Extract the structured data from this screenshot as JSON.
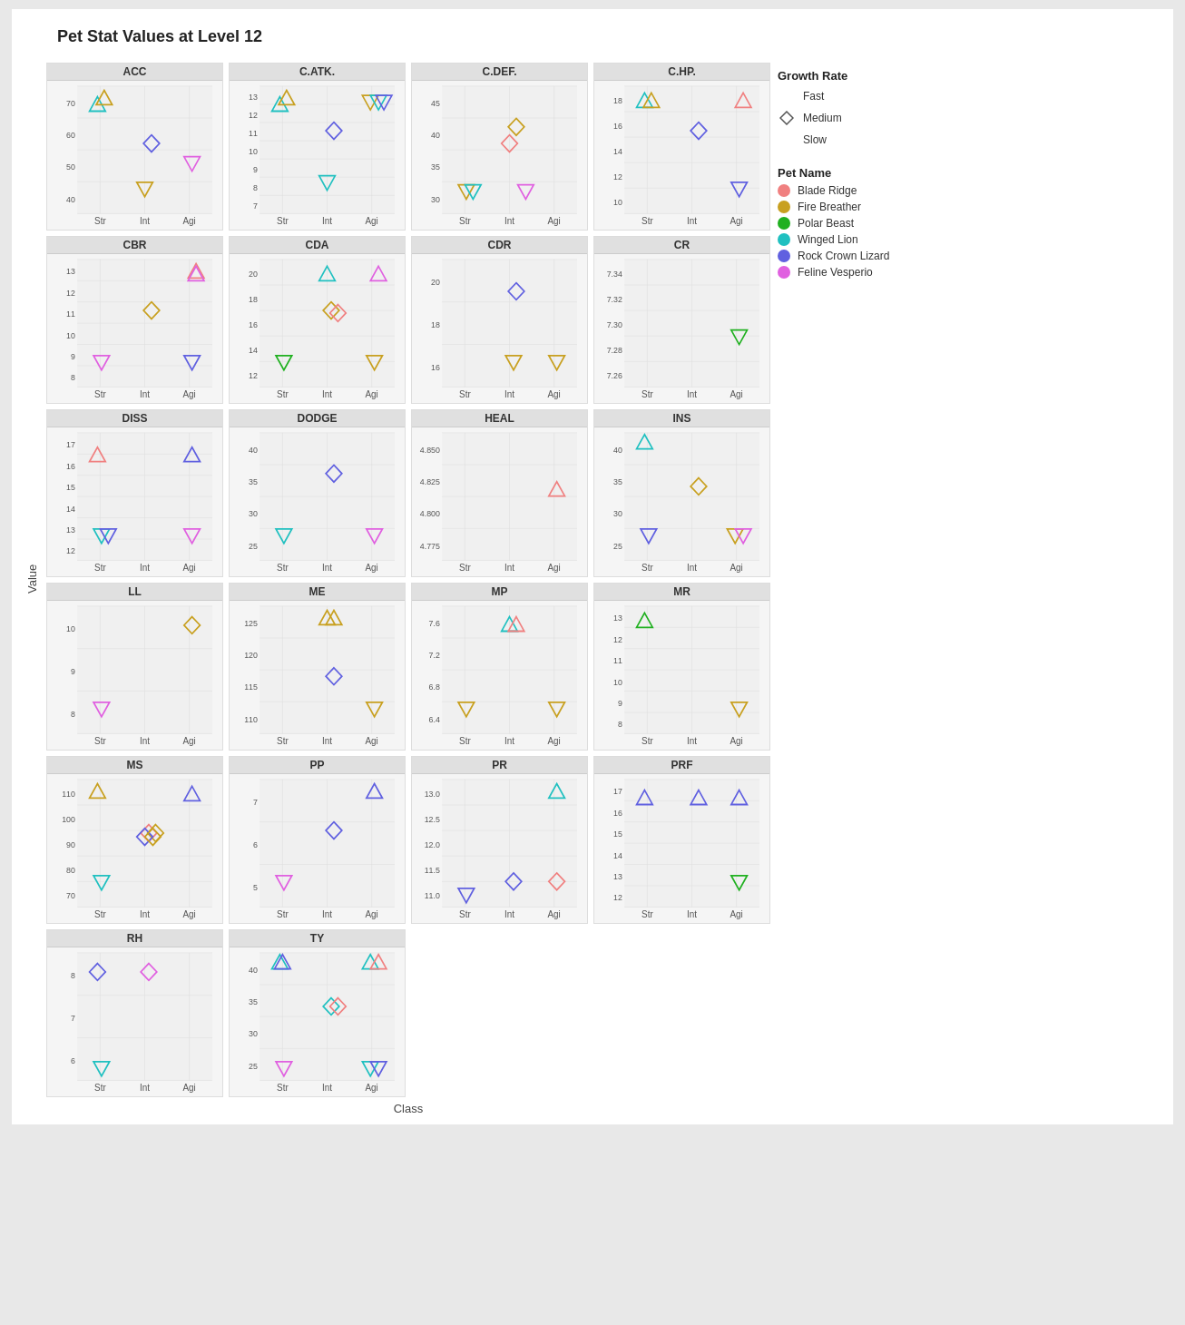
{
  "title": "Pet Stat Values at Level 12",
  "yAxisLabel": "Value",
  "xAxisLabel": "Class",
  "xLabels": [
    "Str",
    "Int",
    "Agi"
  ],
  "legend": {
    "growthRateTitle": "Growth Rate",
    "growthRates": [
      {
        "label": "Fast",
        "shape": "up-triangle"
      },
      {
        "label": "Medium",
        "shape": "diamond"
      },
      {
        "label": "Slow",
        "shape": "down-triangle"
      }
    ],
    "petNameTitle": "Pet Name",
    "petNames": [
      {
        "label": "Blade Ridge",
        "color": "#f08080"
      },
      {
        "label": "Fire Breather",
        "color": "#c8a020"
      },
      {
        "label": "Polar Beast",
        "color": "#20b020"
      },
      {
        "label": "Winged Lion",
        "color": "#20c0c0"
      },
      {
        "label": "Rock Crown Lizard",
        "color": "#6060e0"
      },
      {
        "label": "Feline Vesperio",
        "color": "#e060e0"
      }
    ]
  },
  "plots": [
    {
      "title": "ACC",
      "yMin": 40,
      "yMax": 70,
      "yLabels": [
        "70",
        "60",
        "50",
        "40"
      ],
      "points": [
        {
          "x": 0.15,
          "y": 0.85,
          "shape": "up",
          "color": "#20c0c0"
        },
        {
          "x": 0.2,
          "y": 0.9,
          "shape": "up",
          "color": "#c8a020"
        },
        {
          "x": 0.55,
          "y": 0.55,
          "shape": "diamond",
          "color": "#6060e0"
        },
        {
          "x": 0.5,
          "y": 0.2,
          "shape": "down",
          "color": "#c8a020"
        },
        {
          "x": 0.85,
          "y": 0.4,
          "shape": "down",
          "color": "#e060e0"
        }
      ]
    },
    {
      "title": "C.ATK.",
      "yMin": 7,
      "yMax": 13,
      "yLabels": [
        "13",
        "12",
        "11",
        "10",
        "9",
        "8",
        "7"
      ],
      "points": [
        {
          "x": 0.15,
          "y": 0.85,
          "shape": "up",
          "color": "#20c0c0"
        },
        {
          "x": 0.2,
          "y": 0.9,
          "shape": "up",
          "color": "#c8a020"
        },
        {
          "x": 0.55,
          "y": 0.65,
          "shape": "diamond",
          "color": "#6060e0"
        },
        {
          "x": 0.5,
          "y": 0.25,
          "shape": "down",
          "color": "#20c0c0"
        },
        {
          "x": 0.82,
          "y": 0.88,
          "shape": "down",
          "color": "#c8a020"
        },
        {
          "x": 0.88,
          "y": 0.88,
          "shape": "down",
          "color": "#20c0c0"
        },
        {
          "x": 0.92,
          "y": 0.88,
          "shape": "down",
          "color": "#6060e0"
        }
      ]
    },
    {
      "title": "C.DEF.",
      "yMin": 28,
      "yMax": 48,
      "yLabels": [
        "45",
        "40",
        "35",
        "30"
      ],
      "points": [
        {
          "x": 0.55,
          "y": 0.68,
          "shape": "diamond",
          "color": "#c8a020"
        },
        {
          "x": 0.5,
          "y": 0.55,
          "shape": "diamond",
          "color": "#f08080"
        },
        {
          "x": 0.18,
          "y": 0.18,
          "shape": "down",
          "color": "#c8a020"
        },
        {
          "x": 0.23,
          "y": 0.18,
          "shape": "down",
          "color": "#20c0c0"
        },
        {
          "x": 0.62,
          "y": 0.18,
          "shape": "down",
          "color": "#e060e0"
        }
      ]
    },
    {
      "title": "C.HP.",
      "yMin": 10,
      "yMax": 18,
      "yLabels": [
        "18",
        "16",
        "14",
        "12",
        "10"
      ],
      "points": [
        {
          "x": 0.15,
          "y": 0.88,
          "shape": "up",
          "color": "#20c0c0"
        },
        {
          "x": 0.2,
          "y": 0.88,
          "shape": "up",
          "color": "#c8a020"
        },
        {
          "x": 0.88,
          "y": 0.88,
          "shape": "up",
          "color": "#f08080"
        },
        {
          "x": 0.55,
          "y": 0.65,
          "shape": "diamond",
          "color": "#6060e0"
        },
        {
          "x": 0.85,
          "y": 0.2,
          "shape": "down",
          "color": "#6060e0"
        }
      ]
    },
    {
      "title": "CBR",
      "yMin": 8,
      "yMax": 13,
      "yLabels": [
        "13",
        "12",
        "11",
        "10",
        "9",
        "8"
      ],
      "points": [
        {
          "x": 0.55,
          "y": 0.6,
          "shape": "diamond",
          "color": "#c8a020"
        },
        {
          "x": 0.88,
          "y": 0.9,
          "shape": "up",
          "color": "#f08080"
        },
        {
          "x": 0.88,
          "y": 0.88,
          "shape": "up",
          "color": "#e060e0"
        },
        {
          "x": 0.18,
          "y": 0.2,
          "shape": "down",
          "color": "#e060e0"
        },
        {
          "x": 0.85,
          "y": 0.2,
          "shape": "down",
          "color": "#6060e0"
        }
      ]
    },
    {
      "title": "CDA",
      "yMin": 12,
      "yMax": 20,
      "yLabels": [
        "20",
        "18",
        "16",
        "14",
        "12"
      ],
      "points": [
        {
          "x": 0.5,
          "y": 0.88,
          "shape": "up",
          "color": "#20c0c0"
        },
        {
          "x": 0.88,
          "y": 0.88,
          "shape": "up",
          "color": "#e060e0"
        },
        {
          "x": 0.53,
          "y": 0.6,
          "shape": "diamond",
          "color": "#c8a020"
        },
        {
          "x": 0.58,
          "y": 0.58,
          "shape": "diamond",
          "color": "#f08080"
        },
        {
          "x": 0.18,
          "y": 0.2,
          "shape": "down",
          "color": "#20b020"
        },
        {
          "x": 0.85,
          "y": 0.2,
          "shape": "down",
          "color": "#c8a020"
        }
      ]
    },
    {
      "title": "CDR",
      "yMin": 15,
      "yMax": 21,
      "yLabels": [
        "20",
        "18",
        "16"
      ],
      "points": [
        {
          "x": 0.55,
          "y": 0.75,
          "shape": "diamond",
          "color": "#6060e0"
        },
        {
          "x": 0.53,
          "y": 0.2,
          "shape": "down",
          "color": "#c8a020"
        },
        {
          "x": 0.85,
          "y": 0.2,
          "shape": "down",
          "color": "#c8a020"
        }
      ]
    },
    {
      "title": "CR",
      "yMin": 7.24,
      "yMax": 7.36,
      "yLabels": [
        "7.34",
        "7.32",
        "7.30",
        "7.28",
        "7.26"
      ],
      "points": [
        {
          "x": 0.85,
          "y": 0.4,
          "shape": "down",
          "color": "#20b020"
        }
      ]
    },
    {
      "title": "DISS",
      "yMin": 11,
      "yMax": 18,
      "yLabels": [
        "17",
        "16",
        "15",
        "14",
        "13",
        "12"
      ],
      "points": [
        {
          "x": 0.15,
          "y": 0.82,
          "shape": "up",
          "color": "#f08080"
        },
        {
          "x": 0.85,
          "y": 0.82,
          "shape": "up",
          "color": "#6060e0"
        },
        {
          "x": 0.18,
          "y": 0.2,
          "shape": "down",
          "color": "#20c0c0"
        },
        {
          "x": 0.23,
          "y": 0.2,
          "shape": "down",
          "color": "#6060e0"
        },
        {
          "x": 0.85,
          "y": 0.2,
          "shape": "down",
          "color": "#e060e0"
        }
      ]
    },
    {
      "title": "DODGE",
      "yMin": 23,
      "yMax": 42,
      "yLabels": [
        "40",
        "35",
        "30",
        "25"
      ],
      "points": [
        {
          "x": 0.55,
          "y": 0.68,
          "shape": "diamond",
          "color": "#6060e0"
        },
        {
          "x": 0.18,
          "y": 0.2,
          "shape": "down",
          "color": "#20c0c0"
        },
        {
          "x": 0.85,
          "y": 0.2,
          "shape": "down",
          "color": "#e060e0"
        }
      ]
    },
    {
      "title": "HEAL",
      "yMin": 4.77,
      "yMax": 4.86,
      "yLabels": [
        "4.850",
        "4.825",
        "4.800",
        "4.775"
      ],
      "points": [
        {
          "x": 0.85,
          "y": 0.55,
          "shape": "up",
          "color": "#f08080"
        }
      ]
    },
    {
      "title": "INS",
      "yMin": 22,
      "yMax": 42,
      "yLabels": [
        "40",
        "35",
        "30",
        "25"
      ],
      "points": [
        {
          "x": 0.15,
          "y": 0.92,
          "shape": "up",
          "color": "#20c0c0"
        },
        {
          "x": 0.55,
          "y": 0.58,
          "shape": "diamond",
          "color": "#c8a020"
        },
        {
          "x": 0.18,
          "y": 0.2,
          "shape": "down",
          "color": "#6060e0"
        },
        {
          "x": 0.82,
          "y": 0.2,
          "shape": "down",
          "color": "#c8a020"
        },
        {
          "x": 0.88,
          "y": 0.2,
          "shape": "down",
          "color": "#e060e0"
        }
      ]
    },
    {
      "title": "LL",
      "yMin": 7,
      "yMax": 12,
      "yLabels": [
        "10",
        "9",
        "8"
      ],
      "points": [
        {
          "x": 0.85,
          "y": 0.85,
          "shape": "diamond",
          "color": "#c8a020"
        },
        {
          "x": 0.18,
          "y": 0.2,
          "shape": "down",
          "color": "#e060e0"
        }
      ]
    },
    {
      "title": "ME",
      "yMin": 108,
      "yMax": 128,
      "yLabels": [
        "125",
        "120",
        "115",
        "110"
      ],
      "points": [
        {
          "x": 0.5,
          "y": 0.9,
          "shape": "up",
          "color": "#c8a020"
        },
        {
          "x": 0.55,
          "y": 0.9,
          "shape": "up",
          "color": "#c8a020"
        },
        {
          "x": 0.55,
          "y": 0.45,
          "shape": "diamond",
          "color": "#6060e0"
        },
        {
          "x": 0.85,
          "y": 0.2,
          "shape": "down",
          "color": "#c8a020"
        }
      ]
    },
    {
      "title": "MP",
      "yMin": 6.2,
      "yMax": 7.8,
      "yLabels": [
        "7.6",
        "7.2",
        "6.8",
        "6.4"
      ],
      "points": [
        {
          "x": 0.5,
          "y": 0.85,
          "shape": "up",
          "color": "#20c0c0"
        },
        {
          "x": 0.55,
          "y": 0.85,
          "shape": "up",
          "color": "#f08080"
        },
        {
          "x": 0.18,
          "y": 0.2,
          "shape": "down",
          "color": "#c8a020"
        },
        {
          "x": 0.85,
          "y": 0.2,
          "shape": "down",
          "color": "#c8a020"
        }
      ]
    },
    {
      "title": "MR",
      "yMin": 7,
      "yMax": 14,
      "yLabels": [
        "13",
        "12",
        "11",
        "10",
        "9",
        "8"
      ],
      "points": [
        {
          "x": 0.15,
          "y": 0.88,
          "shape": "up",
          "color": "#20b020"
        },
        {
          "x": 0.85,
          "y": 0.2,
          "shape": "down",
          "color": "#c8a020"
        }
      ]
    },
    {
      "title": "MS",
      "yMin": 65,
      "yMax": 115,
      "yLabels": [
        "110",
        "100",
        "90",
        "80",
        "70"
      ],
      "points": [
        {
          "x": 0.15,
          "y": 0.9,
          "shape": "up",
          "color": "#c8a020"
        },
        {
          "x": 0.85,
          "y": 0.88,
          "shape": "up",
          "color": "#6060e0"
        },
        {
          "x": 0.53,
          "y": 0.58,
          "shape": "diamond",
          "color": "#f08080"
        },
        {
          "x": 0.58,
          "y": 0.58,
          "shape": "diamond",
          "color": "#c8a020"
        },
        {
          "x": 0.5,
          "y": 0.55,
          "shape": "diamond",
          "color": "#6060e0"
        },
        {
          "x": 0.56,
          "y": 0.55,
          "shape": "diamond",
          "color": "#c8a020"
        },
        {
          "x": 0.18,
          "y": 0.2,
          "shape": "down",
          "color": "#20c0c0"
        }
      ]
    },
    {
      "title": "PP",
      "yMin": 4.5,
      "yMax": 8,
      "yLabels": [
        "7",
        "6",
        "5"
      ],
      "points": [
        {
          "x": 0.85,
          "y": 0.9,
          "shape": "up",
          "color": "#6060e0"
        },
        {
          "x": 0.55,
          "y": 0.6,
          "shape": "diamond",
          "color": "#6060e0"
        },
        {
          "x": 0.18,
          "y": 0.2,
          "shape": "down",
          "color": "#e060e0"
        }
      ]
    },
    {
      "title": "PR",
      "yMin": 10.8,
      "yMax": 13.2,
      "yLabels": [
        "13.0",
        "12.5",
        "12.0",
        "11.5",
        "11.0"
      ],
      "points": [
        {
          "x": 0.85,
          "y": 0.9,
          "shape": "up",
          "color": "#20c0c0"
        },
        {
          "x": 0.53,
          "y": 0.2,
          "shape": "diamond",
          "color": "#6060e0"
        },
        {
          "x": 0.85,
          "y": 0.2,
          "shape": "diamond",
          "color": "#f08080"
        },
        {
          "x": 0.18,
          "y": 0.1,
          "shape": "down",
          "color": "#6060e0"
        }
      ]
    },
    {
      "title": "PRF",
      "yMin": 11,
      "yMax": 18,
      "yLabels": [
        "17",
        "16",
        "15",
        "14",
        "13",
        "12"
      ],
      "points": [
        {
          "x": 0.15,
          "y": 0.85,
          "shape": "up",
          "color": "#6060e0"
        },
        {
          "x": 0.55,
          "y": 0.85,
          "shape": "up",
          "color": "#6060e0"
        },
        {
          "x": 0.85,
          "y": 0.85,
          "shape": "up",
          "color": "#6060e0"
        },
        {
          "x": 0.85,
          "y": 0.2,
          "shape": "down",
          "color": "#20b020"
        }
      ]
    },
    {
      "title": "RH",
      "yMin": 5.5,
      "yMax": 10,
      "yLabels": [
        "8",
        "7",
        "6"
      ],
      "points": [
        {
          "x": 0.15,
          "y": 0.85,
          "shape": "diamond",
          "color": "#6060e0"
        },
        {
          "x": 0.53,
          "y": 0.85,
          "shape": "diamond",
          "color": "#e060e0"
        },
        {
          "x": 0.18,
          "y": 0.1,
          "shape": "down",
          "color": "#20c0c0"
        }
      ]
    },
    {
      "title": "TY",
      "yMin": 23,
      "yMax": 42,
      "yLabels": [
        "40",
        "35",
        "30",
        "25"
      ],
      "points": [
        {
          "x": 0.15,
          "y": 0.92,
          "shape": "up",
          "color": "#20c0c0"
        },
        {
          "x": 0.17,
          "y": 0.92,
          "shape": "up",
          "color": "#6060e0"
        },
        {
          "x": 0.82,
          "y": 0.92,
          "shape": "up",
          "color": "#20c0c0"
        },
        {
          "x": 0.88,
          "y": 0.92,
          "shape": "up",
          "color": "#f08080"
        },
        {
          "x": 0.53,
          "y": 0.58,
          "shape": "diamond",
          "color": "#20c0c0"
        },
        {
          "x": 0.58,
          "y": 0.58,
          "shape": "diamond",
          "color": "#f08080"
        },
        {
          "x": 0.18,
          "y": 0.1,
          "shape": "down",
          "color": "#e060e0"
        },
        {
          "x": 0.82,
          "y": 0.1,
          "shape": "down",
          "color": "#20c0c0"
        },
        {
          "x": 0.88,
          "y": 0.1,
          "shape": "down",
          "color": "#6060e0"
        }
      ]
    }
  ]
}
